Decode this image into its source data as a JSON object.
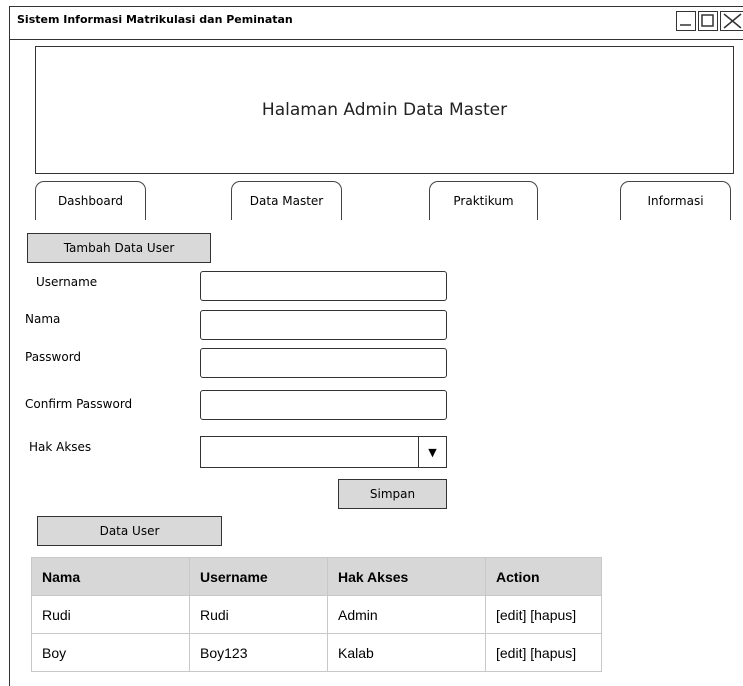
{
  "window": {
    "title": "Sistem Informasi Matrikulasi dan Peminatan"
  },
  "banner": {
    "text": "Halaman Admin Data Master"
  },
  "nav": {
    "tabs": [
      {
        "label": "Dashboard"
      },
      {
        "label": "Data Master"
      },
      {
        "label": "Praktikum"
      },
      {
        "label": "Informasi"
      }
    ]
  },
  "form": {
    "section_title": "Tambah Data User",
    "fields": [
      {
        "label": "Username",
        "value": ""
      },
      {
        "label": "Nama",
        "value": ""
      },
      {
        "label": "Password",
        "value": ""
      },
      {
        "label": "Confirm Password",
        "value": ""
      },
      {
        "label": "Hak Akses",
        "value": ""
      }
    ],
    "submit_label": "Simpan"
  },
  "users": {
    "section_title": "Data User",
    "columns": [
      "Nama",
      "Username",
      "Hak Akses",
      "Action"
    ],
    "rows": [
      [
        "Rudi",
        "Rudi",
        "Admin",
        "[edit] [hapus]"
      ],
      [
        "Boy",
        "Boy123",
        "Kalab",
        "[edit] [hapus]"
      ]
    ]
  }
}
